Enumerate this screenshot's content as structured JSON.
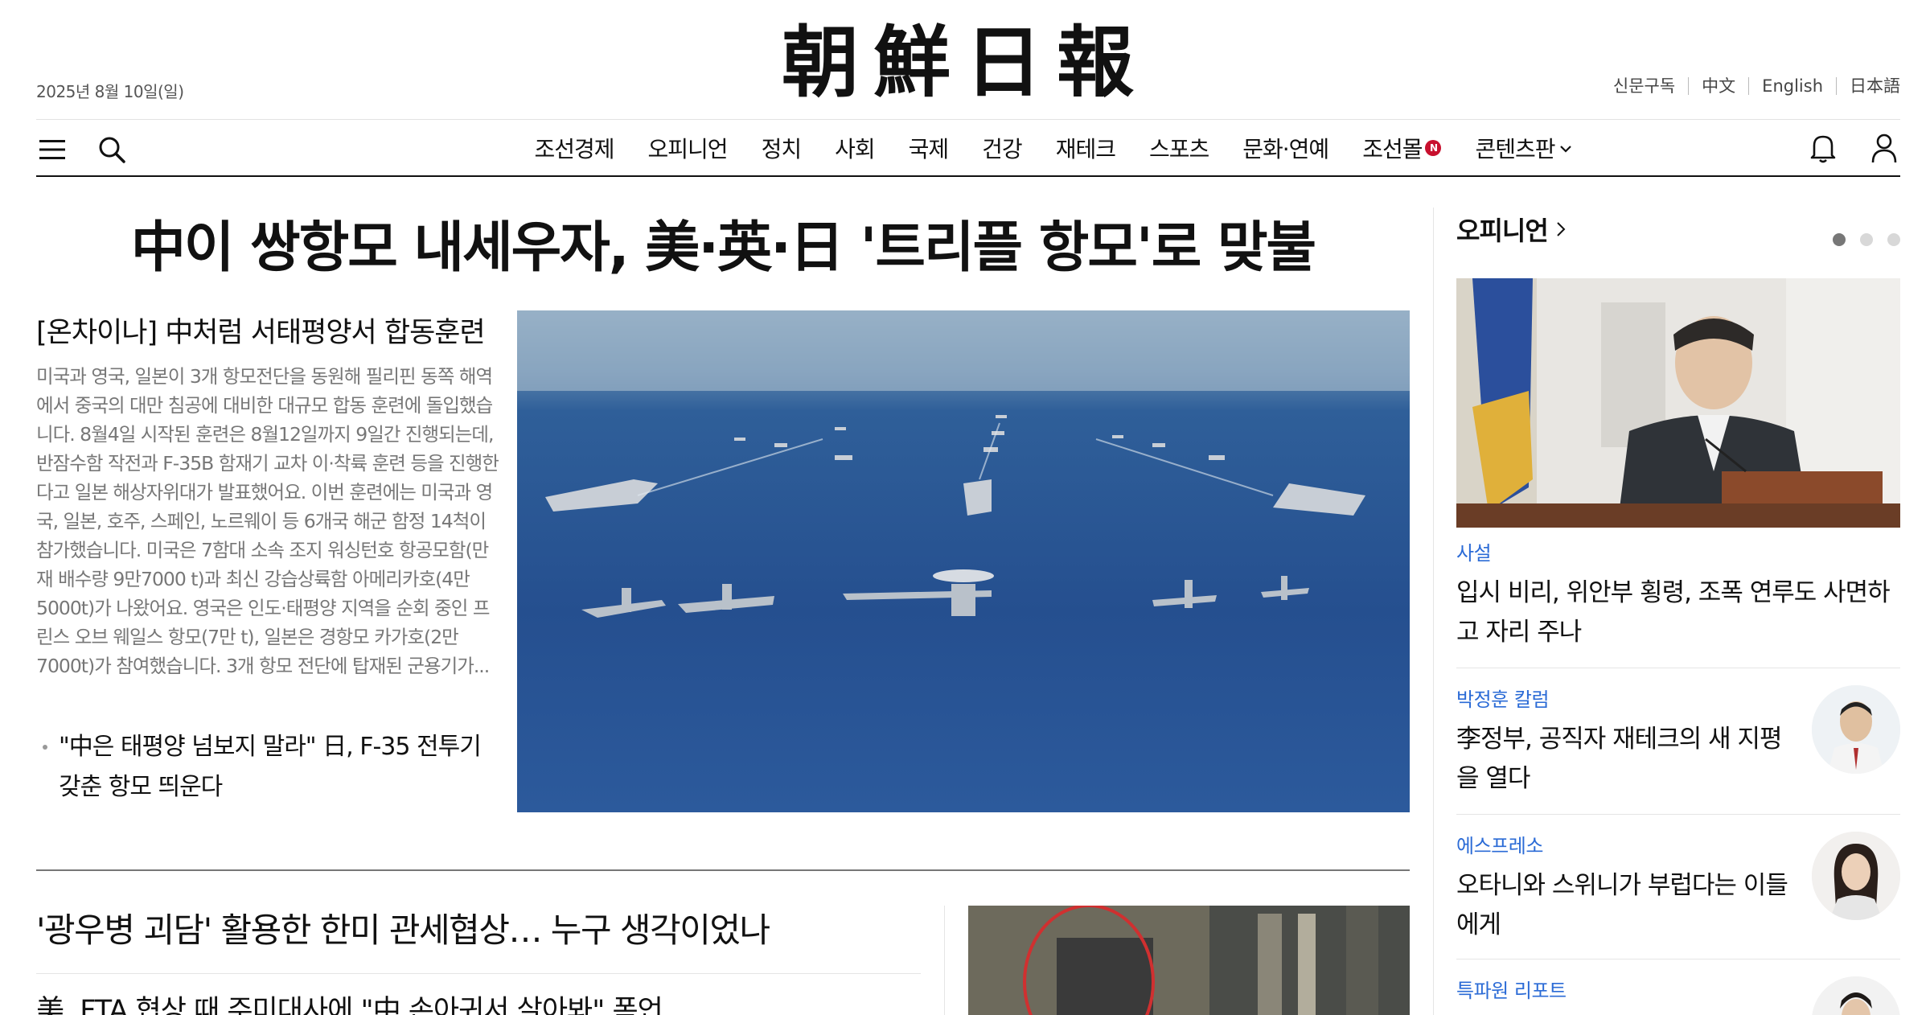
{
  "header": {
    "date": "2025년 8월 10일(일)",
    "logo": "朝鮮日報",
    "lang_links": [
      "신문구독",
      "中文",
      "English",
      "日本語"
    ]
  },
  "nav": {
    "items": [
      "조선경제",
      "오피니언",
      "정치",
      "사회",
      "국제",
      "건강",
      "재테크",
      "스포츠",
      "문화·연예",
      "조선몰",
      "콘텐츠판"
    ],
    "badge": "N"
  },
  "main": {
    "headline": "中이 쌍항모 내세우자, 美·英·日 '트리플 항모'로 맞불",
    "lead_subtitle": "[온차이나] 中처럼 서태평양서 합동훈련",
    "lead_summary": "미국과 영국, 일본이 3개 항모전단을 동원해 필리핀 동쪽 해역에서 중국의 대만 침공에 대비한 대규모 합동 훈련에 돌입했습니다. 8월4일 시작된 훈련은 8월12일까지 9일간 진행되는데, 반잠수함 작전과 F-35B 함재기 교차 이·착륙 훈련 등을 진행한다고 일본 해상자위대가 발표했어요. 이번 훈련에는 미국과 영국, 일본, 호주, 스페인, 노르웨이 등 6개국 해군 함정 14척이 참가했습니다. 미국은 7함대 소속 조지 워싱턴호 항공모함(만재 배수량 9만7000 t)과 최신 강습상륙함 아메리카호(4만5000t)가 나왔어요. 영국은 인도·태평양 지역을 순회 중인 프린스 오브 웨일스 항모(7만 t), 일본은 경항모 카가호(2만7000t)가 참여했습니다. 3개 항모 전단에 탑재된 군용기가...",
    "lead_related": "\"中은 태평양 넘보지 말라\" 日, F-35 전투기 갖춘 항모 띄운다",
    "story2_title": "'광우병 괴담' 활용한 한미 관세협상… 누구 생각이었나",
    "story3_title": "美, FTA 협상 때 주미대사에 \"中 손아귀서 살아봐\" 폭언"
  },
  "sidebar": {
    "title": "오피니언",
    "items": [
      {
        "category": "사설",
        "headline": "입시 비리, 위안부 횡령, 조폭 연루도 사면하고 자리 주나"
      },
      {
        "category": "박정훈 칼럼",
        "headline": "李정부, 공직자 재테크의 새 지평을 열다"
      },
      {
        "category": "에스프레소",
        "headline": "오타니와 스위니가 부럽다는 이들에게"
      },
      {
        "category": "특파원 리포트",
        "headline": ""
      }
    ]
  },
  "colors": {
    "accent_blue": "#2b6bd6",
    "badge_red": "#c8102e"
  }
}
